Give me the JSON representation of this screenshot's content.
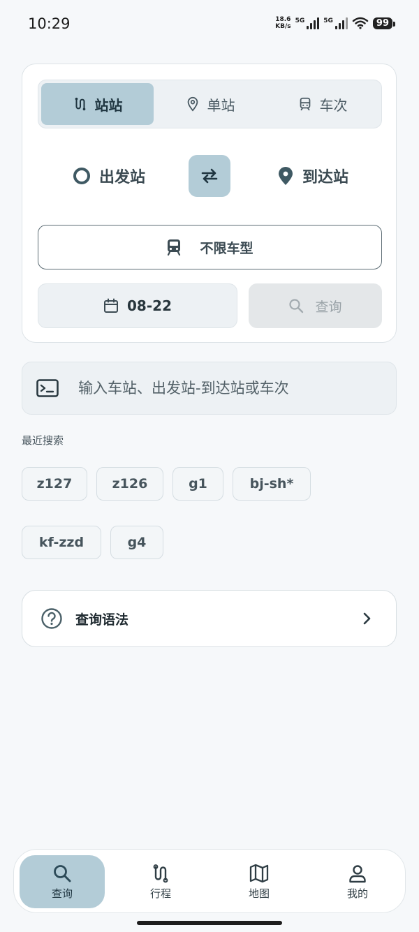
{
  "status": {
    "time": "10:29",
    "speed_value": "18.6",
    "speed_unit": "KB/s",
    "net1": "5G",
    "net2": "5G",
    "battery": "99"
  },
  "search_mode": {
    "tabs": [
      {
        "label": "站站",
        "icon": "route-icon",
        "active": true
      },
      {
        "label": "单站",
        "icon": "location-pin-icon",
        "active": false
      },
      {
        "label": "车次",
        "icon": "train-icon",
        "active": false
      }
    ]
  },
  "stations": {
    "from_label": "出发站",
    "to_label": "到达站"
  },
  "train_type": {
    "label": "不限车型"
  },
  "date": {
    "label": "08-22"
  },
  "query": {
    "label": "查询"
  },
  "command_input": {
    "placeholder": "输入车站、出发站-到达站或车次",
    "value": ""
  },
  "recent": {
    "title": "最近搜索",
    "items": [
      "z127",
      "z126",
      "g1",
      "bj-sh*",
      "kf-zzd",
      "g4"
    ]
  },
  "syntax_help": {
    "label": "查询语法"
  },
  "bottom_nav": {
    "items": [
      {
        "label": "查询",
        "icon": "search-icon",
        "active": true
      },
      {
        "label": "行程",
        "icon": "route-icon",
        "active": false
      },
      {
        "label": "地图",
        "icon": "map-icon",
        "active": false
      },
      {
        "label": "我的",
        "icon": "person-icon",
        "active": false
      }
    ]
  },
  "colors": {
    "accent": "#b3ccd7",
    "surface": "#edf1f4",
    "background": "#f6f8fa"
  }
}
